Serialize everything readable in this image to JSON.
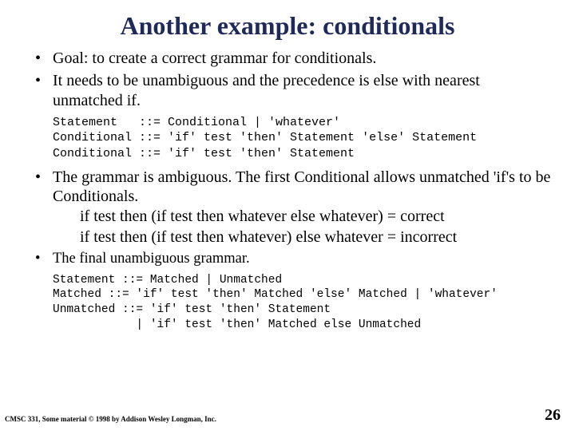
{
  "title": "Another example: conditionals",
  "bullets": {
    "b1": "Goal: to create a correct grammar for conditionals.",
    "b2": "It needs to be unambiguous and the precedence is else with nearest unmatched if.",
    "b3": "The grammar is ambiguous. The first Conditional allows unmatched 'if's to be Conditionals.",
    "b3s1": "if test then (if test then whatever else whatever) = correct",
    "b3s2": "if test then (if test then whatever) else whatever = incorrect",
    "b4": "The final unambiguous grammar."
  },
  "code1": "Statement   ::= Conditional | 'whatever'\nConditional ::= 'if' test 'then' Statement 'else' Statement\nConditional ::= 'if' test 'then' Statement",
  "code2": "Statement ::= Matched | Unmatched\nMatched ::= 'if' test 'then' Matched 'else' Matched | 'whatever'\nUnmatched ::= 'if' test 'then' Statement\n            | 'if' test 'then' Matched else Unmatched",
  "footer": {
    "left": "CMSC 331, Some material © 1998 by Addison Wesley Longman, Inc.",
    "page": "26"
  }
}
